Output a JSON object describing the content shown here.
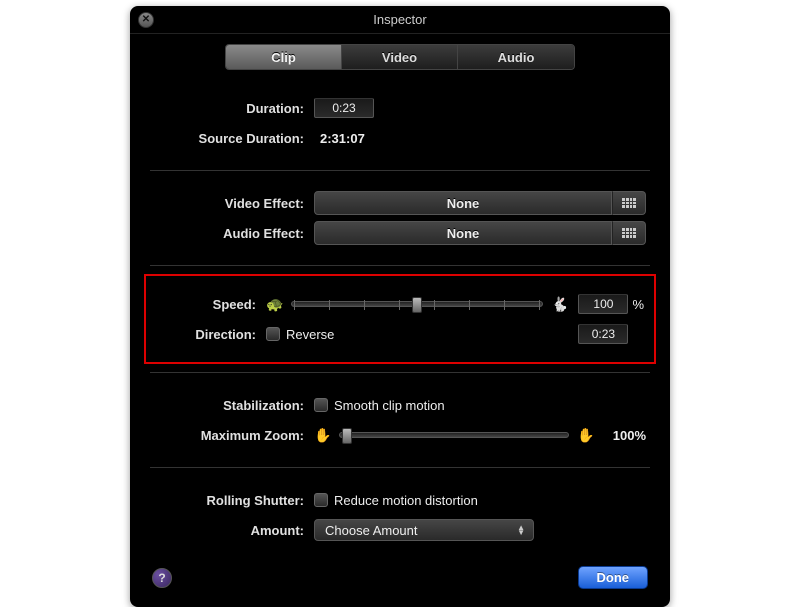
{
  "window": {
    "title": "Inspector"
  },
  "tabs": {
    "clip": "Clip",
    "video": "Video",
    "audio": "Audio",
    "active": "Clip"
  },
  "duration": {
    "label": "Duration:",
    "value": "0:23"
  },
  "source_duration": {
    "label": "Source Duration:",
    "value": "2:31:07"
  },
  "video_effect": {
    "label": "Video Effect:",
    "value": "None"
  },
  "audio_effect": {
    "label": "Audio Effect:",
    "value": "None"
  },
  "speed": {
    "label": "Speed:",
    "value": "100",
    "unit": "%",
    "slider_percent": 50
  },
  "direction": {
    "label": "Direction:",
    "checkbox_label": "Reverse",
    "time": "0:23"
  },
  "stabilization": {
    "label": "Stabilization:",
    "checkbox_label": "Smooth clip motion"
  },
  "max_zoom": {
    "label": "Maximum Zoom:",
    "value": "100%",
    "slider_percent": 0
  },
  "rolling_shutter": {
    "label": "Rolling Shutter:",
    "checkbox_label": "Reduce motion distortion"
  },
  "amount": {
    "label": "Amount:",
    "value": "Choose Amount"
  },
  "footer": {
    "done": "Done",
    "help": "?"
  },
  "icons": {
    "turtle": "🐢",
    "rabbit": "🐇",
    "hand": "✋"
  }
}
